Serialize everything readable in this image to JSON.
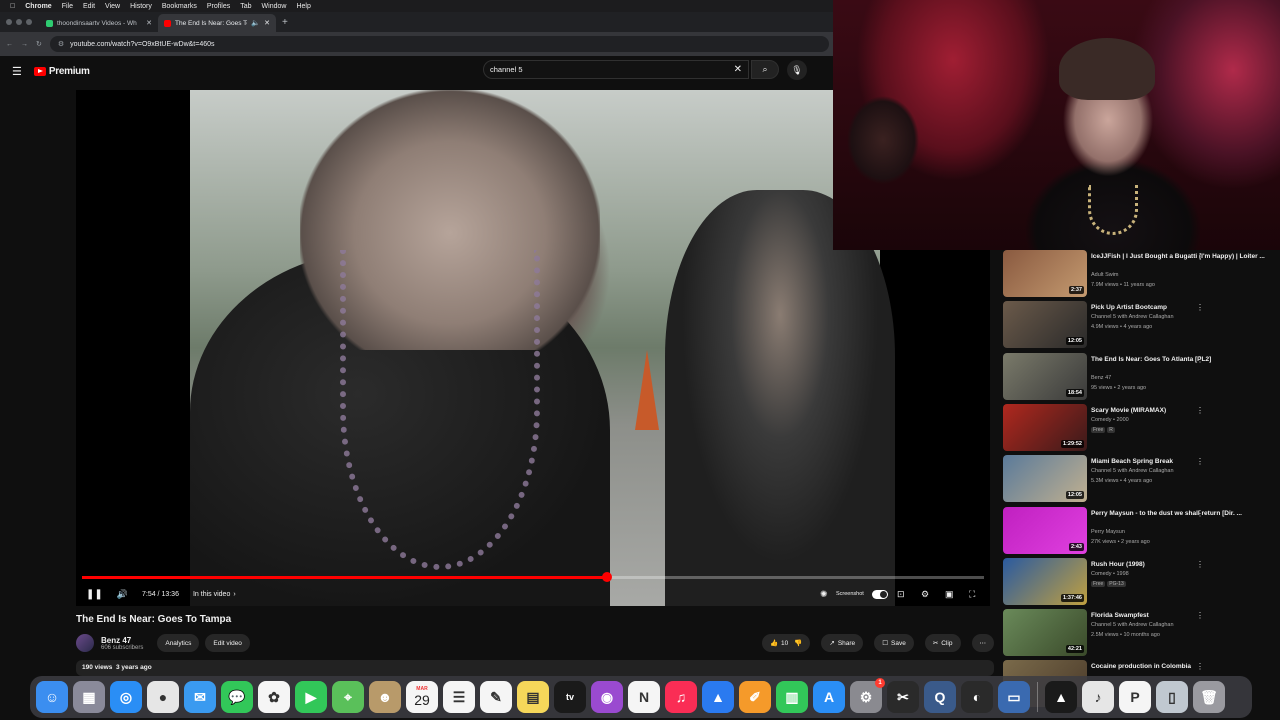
{
  "menubar": {
    "items": [
      "Chrome",
      "File",
      "Edit",
      "View",
      "History",
      "Bookmarks",
      "Profiles",
      "Tab",
      "Window",
      "Help"
    ]
  },
  "tabs": [
    {
      "title": "thoondinsaartv Videos - Wh",
      "favicon_color": "#2ecc71"
    },
    {
      "title": "The End Is Near: Goes To",
      "favicon_color": "#ff0000"
    }
  ],
  "address": {
    "url": "youtube.com/watch?v=O9xBtUE-wDw&t=460s"
  },
  "youtube": {
    "logo_text": "Premium",
    "search_value": "channel 5"
  },
  "player": {
    "progress": 0.582,
    "time_current": "7:54",
    "time_separator": " / ",
    "time_total": "13:36",
    "in_this_video": "In this video",
    "screenshot_label": "Screenshot"
  },
  "video": {
    "title": "The End Is Near: Goes To Tampa",
    "channel_name": "Benz 47",
    "subscribers": "606 subscribers",
    "analytics_label": "Analytics",
    "edit_label": "Edit video",
    "likes": "10",
    "share_label": "Share",
    "save_label": "Save",
    "clip_label": "Clip",
    "meta": "190 views  3 years ago"
  },
  "recommendations": [
    {
      "title": "IceJJFish | I Just Bought a Bugatti (I'm Happy) | Loiter ...",
      "channel": "Adult Swim",
      "stats": "7.9M views • 11 years ago",
      "duration": "2:37",
      "thumb": [
        "#8a5a40",
        "#c49a70"
      ],
      "badges": []
    },
    {
      "title": "Pick Up Artist Bootcamp",
      "channel": "Channel 5 with Andrew Callaghan",
      "stats": "4.9M views • 4 years ago",
      "duration": "12:05",
      "thumb": [
        "#6b5a4a",
        "#2a2a2a"
      ],
      "badges": []
    },
    {
      "title": "The End Is Near: Goes To Atlanta [PL2]",
      "channel": "Benz 47",
      "stats": "95 views • 2 years ago",
      "duration": "18:54",
      "thumb": [
        "#7a7a6a",
        "#3a3a3a"
      ],
      "badges": []
    },
    {
      "title": "Scary Movie (MIRAMAX)",
      "channel": "Comedy • 2000",
      "stats": "",
      "duration": "1:29:52",
      "thumb": [
        "#b0281e",
        "#3a1a1a"
      ],
      "badges": [
        "Free",
        "R"
      ]
    },
    {
      "title": "Miami Beach Spring Break",
      "channel": "Channel 5 with Andrew Callaghan",
      "stats": "5.3M views • 4 years ago",
      "duration": "12:05",
      "thumb": [
        "#5a7a9a",
        "#c0b090"
      ],
      "badges": []
    },
    {
      "title": "Perry Maysun - to the dust we shall return [Dir. ...",
      "channel": "Perry Maysun",
      "stats": "27K views • 2 years ago",
      "duration": "2:43",
      "thumb": [
        "#c020c0",
        "#e040e0"
      ],
      "badges": []
    },
    {
      "title": "Rush Hour (1998)",
      "channel": "Comedy • 1998",
      "stats": "",
      "duration": "1:37:46",
      "thumb": [
        "#2a5aa0",
        "#c0a040"
      ],
      "badges": [
        "Free",
        "PG-13"
      ]
    },
    {
      "title": "Florida Swampfest",
      "channel": "Channel 5 with Andrew Callaghan",
      "stats": "2.5M views • 10 months ago",
      "duration": "42:21",
      "thumb": [
        "#6a8a5a",
        "#3a4a2a"
      ],
      "badges": []
    },
    {
      "title": "Cocaine production in Colombia",
      "channel": "",
      "stats": "",
      "duration": "",
      "thumb": [
        "#7a6a4a",
        "#4a3a2a"
      ],
      "badges": []
    }
  ],
  "dock": {
    "calendar_month": "MAR",
    "calendar_day": "29",
    "tv_label": "tv",
    "settings_badge": "1",
    "apps": [
      {
        "name": "finder-icon",
        "color": "#3b8ef0",
        "glyph": "☺"
      },
      {
        "name": "launchpad-icon",
        "color": "#8a8a9a",
        "glyph": "▦"
      },
      {
        "name": "safari-icon",
        "color": "#2a8ef5",
        "glyph": "◎"
      },
      {
        "name": "chrome-icon",
        "color": "#e6e6e6",
        "glyph": "●"
      },
      {
        "name": "mail-icon",
        "color": "#3a9af0",
        "glyph": "✉"
      },
      {
        "name": "messages-icon",
        "color": "#32c759",
        "glyph": "💬"
      },
      {
        "name": "photos-icon",
        "color": "#f5f5f5",
        "glyph": "✿"
      },
      {
        "name": "facetime-icon",
        "color": "#32c759",
        "glyph": "▶"
      },
      {
        "name": "maps-icon",
        "color": "#5ac05a",
        "glyph": "⌖"
      },
      {
        "name": "contacts-icon",
        "color": "#b89a6a",
        "glyph": "☻"
      }
    ],
    "apps2": [
      {
        "name": "reminders-icon",
        "color": "#f5f5f5",
        "glyph": "☰"
      },
      {
        "name": "freeform-icon",
        "color": "#f5f5f5",
        "glyph": "✎"
      },
      {
        "name": "notes-icon",
        "color": "#f5d75a",
        "glyph": "▤"
      }
    ],
    "apps3": [
      {
        "name": "podcasts-icon",
        "color": "#9a4ad0",
        "glyph": "◉"
      },
      {
        "name": "news-icon",
        "color": "#f5f5f5",
        "glyph": "N"
      },
      {
        "name": "music-icon",
        "color": "#fa2d55",
        "glyph": "♫"
      },
      {
        "name": "keynote-icon",
        "color": "#2a7af0",
        "glyph": "▲"
      },
      {
        "name": "pages-icon",
        "color": "#f59a2a",
        "glyph": "✐"
      },
      {
        "name": "numbers-icon",
        "color": "#32c759",
        "glyph": "▥"
      },
      {
        "name": "app-store-icon",
        "color": "#2a8ef5",
        "glyph": "A"
      }
    ],
    "apps4": [
      {
        "name": "final-cut-icon",
        "color": "#2a2a2a",
        "glyph": "✂"
      },
      {
        "name": "quicktime-icon",
        "color": "#3a5a8a",
        "glyph": "Q"
      },
      {
        "name": "obs-icon",
        "color": "#2a2a2a",
        "glyph": "◐"
      },
      {
        "name": "screen-sharing-icon",
        "color": "#3a6ab0",
        "glyph": "▭"
      }
    ],
    "apps5": [
      {
        "name": "finder-window-icon",
        "color": "#1a1a1a",
        "glyph": "▲"
      },
      {
        "name": "audio-file-icon",
        "color": "#e6e6e6",
        "glyph": "♪"
      },
      {
        "name": "pdf-file-icon",
        "color": "#f5f5f5",
        "glyph": "P"
      },
      {
        "name": "document-icon",
        "color": "#c0c8d0",
        "glyph": "▯"
      },
      {
        "name": "trash-icon",
        "color": "#9a9aa0",
        "glyph": "🗑"
      }
    ]
  },
  "colors": {
    "accent": "#ff0000",
    "background": "#0f0f0f"
  }
}
